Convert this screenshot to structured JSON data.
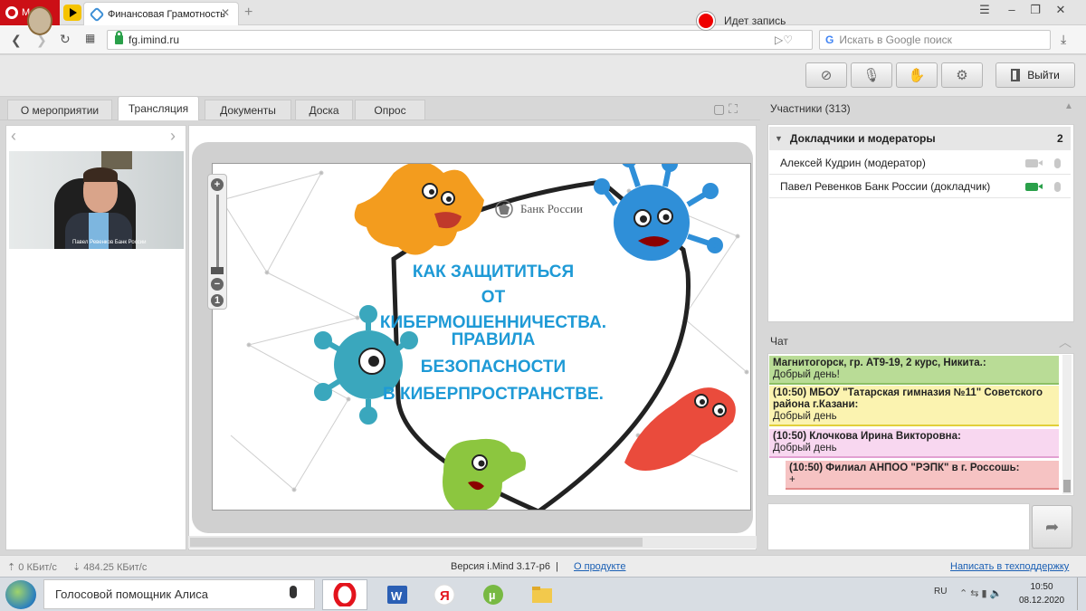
{
  "browser": {
    "menu_label": "Меню",
    "tab_title": "Финансовая Грамотность",
    "tab_close": "✕",
    "new_tab": "+",
    "url": "fg.imind.ru",
    "search_placeholder": "Искать в Google поиск",
    "search_logo": "G"
  },
  "app": {
    "recording_label": "Идет запись",
    "exit_label": "Выйти"
  },
  "tabs": [
    {
      "label": "О мероприятии",
      "active": false
    },
    {
      "label": "Трансляция",
      "active": true
    },
    {
      "label": "Документы",
      "active": false
    },
    {
      "label": "Доска",
      "active": false
    },
    {
      "label": "Опрос",
      "active": false
    }
  ],
  "video": {
    "caption": "Павел Ревенков Банк России"
  },
  "slide": {
    "logo_text": "Банк России",
    "heading_lines": [
      "КАК ЗАЩИТИТЬСЯ",
      "ОТ КИБЕРМОШЕННИЧЕСТВА."
    ],
    "subheading_lines": [
      "ПРАВИЛА",
      "БЕЗОПАСНОСТИ",
      "В КИБЕРПРОСТРАНСТВЕ."
    ],
    "text_color": "#1e9ad6"
  },
  "zoom": {
    "plus": "+",
    "minus": "−",
    "one": "1"
  },
  "participants": {
    "title": "Участники (313)",
    "group_label": "Докладчики и модераторы",
    "group_count": "2",
    "people": [
      {
        "name": "Алексей Кудрин (модератор)",
        "camera_on": false
      },
      {
        "name": "Павел Ревенков Банк России (докладчик)",
        "camera_on": true
      }
    ]
  },
  "chat": {
    "title": "Чат",
    "messages": [
      {
        "author": "Магнитогорск, гр. АТ9-19, 2 курс, Никита.:",
        "text": "Добрый день!",
        "color": "#b9dc96",
        "border": "#8cc063"
      },
      {
        "author": "(10:50) МБОУ \"Татарская гимназия №11\" Советского района г.Казани:",
        "text": "Добрый день",
        "color": "#fbf3b0",
        "border": "#e2cf3a"
      },
      {
        "author": "(10:50) Клочкова Ирина Викторовна:",
        "text": "Добрый день",
        "color": "#f8d7f0",
        "border": "#e2a0d2"
      },
      {
        "author": "(10:50) Филиал АНПОО \"РЭПК\" в г. Россошь:",
        "text": "+",
        "color": "#f6c3c3",
        "border": "#e28b8b"
      }
    ]
  },
  "statusbar": {
    "upload": "0 КБит/с",
    "download": "484.25 КБит/с",
    "version": "Версия i.Mind 3.17-p6",
    "separator": "|",
    "about_link": "О продукте",
    "support_link": "Написать в техподдержку"
  },
  "taskbar": {
    "search_text": "Голосовой помощник Алиса",
    "lang": "RU",
    "time": "10:50",
    "date": "08.12.2020"
  },
  "colors": {
    "record": "#e00000",
    "camera_on": "#2aa04a",
    "link": "#1a5fb4"
  },
  "icons": [
    "menu-icon",
    "play-icon",
    "back-icon",
    "forward-icon",
    "reload-icon",
    "grid-icon",
    "lock-icon",
    "download-icon",
    "camera-off-icon",
    "mic-off-icon",
    "hand-icon",
    "gear-icon",
    "door-icon",
    "send-icon",
    "opera-icon",
    "word-icon",
    "yandex-icon",
    "utorrent-icon",
    "folder-icon"
  ]
}
